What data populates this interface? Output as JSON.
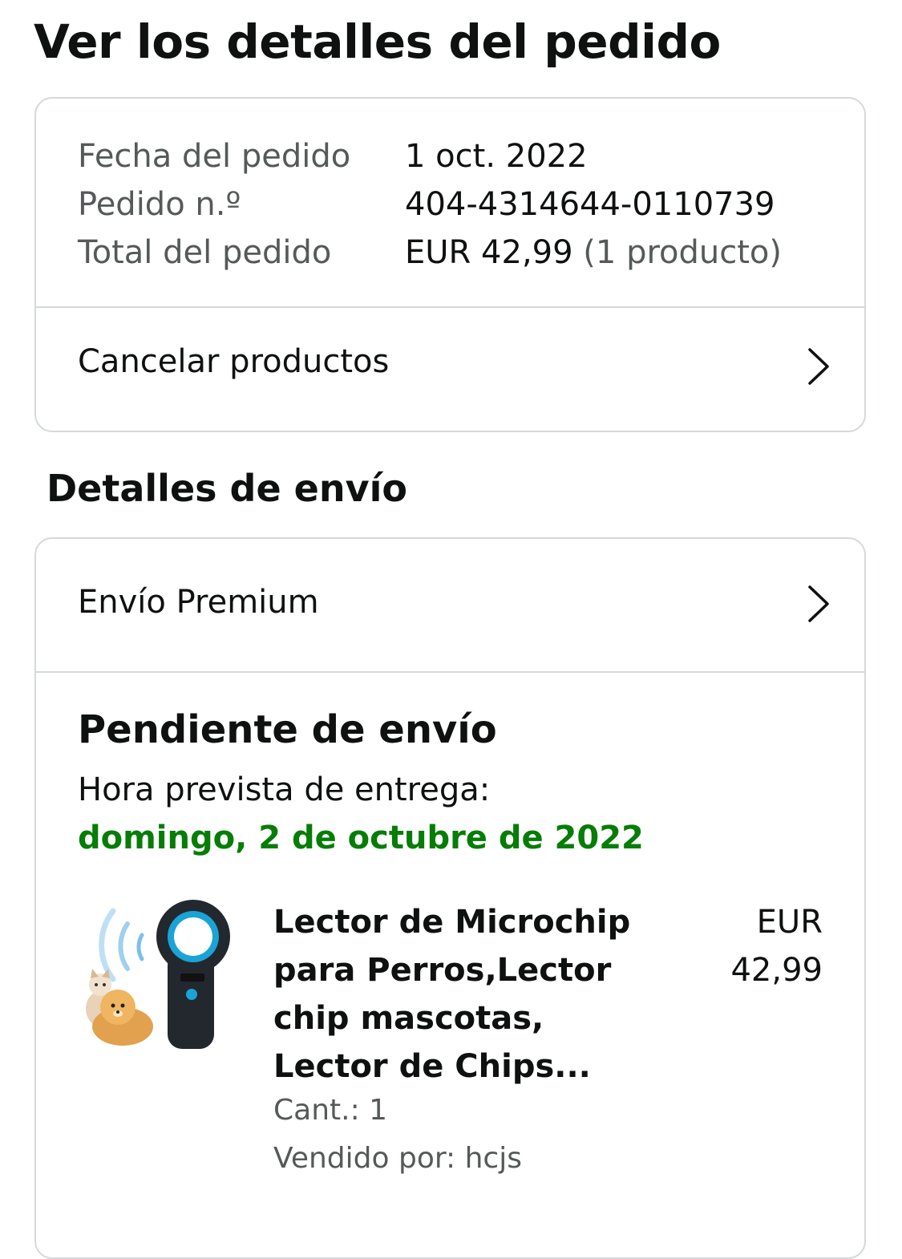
{
  "page": {
    "title": "Ver los detalles del pedido"
  },
  "summary": {
    "rows": [
      {
        "label": "Fecha del pedido",
        "value": "1 oct. 2022"
      },
      {
        "label": "Pedido n.º",
        "value": "404-4314644-0110739"
      },
      {
        "label": "Total del pedido",
        "value": "EUR 42,99",
        "extra": "(1 producto)"
      }
    ],
    "cancel_label": "Cancelar productos",
    "cancel_icon": "chevron-right-icon"
  },
  "shipping": {
    "section_title": "Detalles de envío",
    "method_label": "Envío Premium",
    "method_icon": "chevron-right-icon",
    "status": "Pendiente de envío",
    "delivery_label": "Hora prevista de entrega:",
    "delivery_date": "domingo, 2 de octubre de 2022",
    "delivery_color": "#067d06"
  },
  "product": {
    "title": "Lector de Microchip para Perros,Lector chip mascotas, Lector de Chips...",
    "currency": "EUR",
    "price": "42,99",
    "quantity": "Cant.: 1",
    "seller": "Vendido por: hcjs"
  }
}
